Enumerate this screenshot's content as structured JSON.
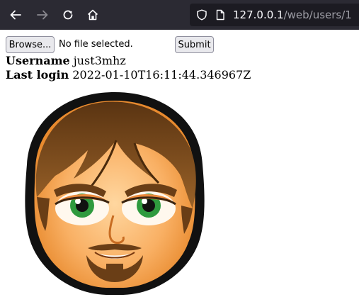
{
  "browser": {
    "url_host": "127.0.0.1",
    "url_path": "/web/users/1",
    "icons": [
      "back-arrow-icon",
      "forward-arrow-icon",
      "reload-icon",
      "home-icon",
      "shield-icon",
      "page-icon"
    ]
  },
  "form": {
    "browse_label": "Browse...",
    "file_status": "No file selected.",
    "submit_label": "Submit"
  },
  "profile": {
    "username_label": "Username",
    "username_value": "just3mhz",
    "last_login_label": "Last login",
    "last_login_value": "2022-01-10T16:11:44.346967Z",
    "avatar": "cartoon-man-avatar"
  },
  "colors": {
    "toolbar": "#2b2a33",
    "urlbar": "#1c1b22",
    "skin": "#f7a24a",
    "hair": "#7a4a1c",
    "eyes": "#2f9a3e"
  }
}
